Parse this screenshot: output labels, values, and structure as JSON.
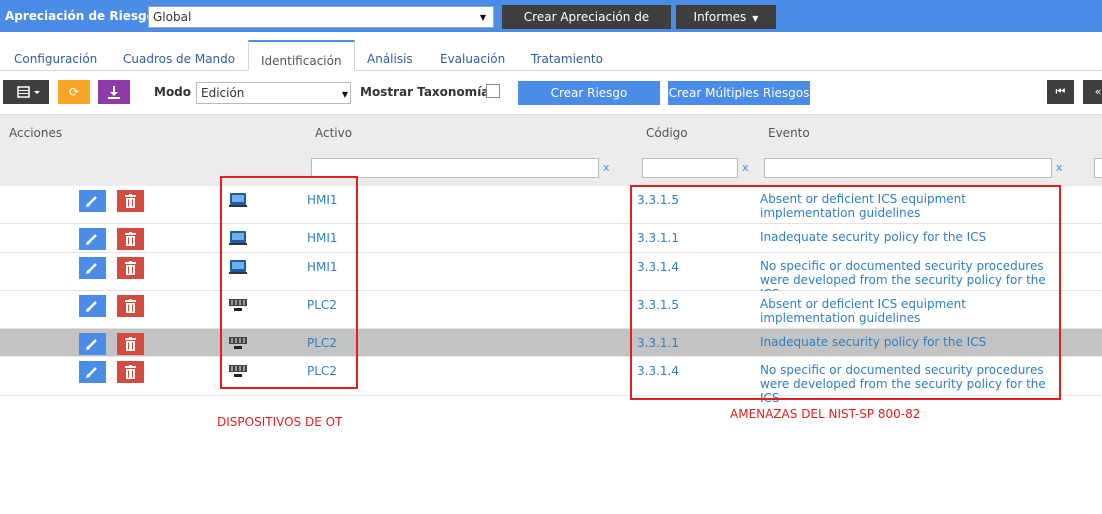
{
  "topbar": {
    "title": "Apreciación de Riesgos",
    "scope_value": "Global",
    "create_button": "Crear Apreciación de Riesgos",
    "reports_button": "Informes"
  },
  "tabs": [
    {
      "label": "Configuración"
    },
    {
      "label": "Cuadros de Mando"
    },
    {
      "label": "Identificación",
      "active": true
    },
    {
      "label": "Análisis"
    },
    {
      "label": "Evaluación"
    },
    {
      "label": "Tratamiento"
    }
  ],
  "toolbar": {
    "mode_label": "Modo",
    "mode_value": "Edición",
    "taxonomy_label": "Mostrar Taxonomía",
    "create_risk": "Crear Riesgo",
    "create_multiple": "Crear Múltiples Riesgos"
  },
  "table": {
    "columns": [
      "Acciones",
      "Activo",
      "Código",
      "Evento"
    ],
    "filter_clear": "x",
    "rows": [
      {
        "activo": "HMI1",
        "device": "hmi",
        "codigo": "3.3.1.5",
        "evento": "Absent or deficient ICS equipment implementation guidelines"
      },
      {
        "activo": "HMI1",
        "device": "hmi",
        "codigo": "3.3.1.1",
        "evento": "Inadequate security policy for the ICS"
      },
      {
        "activo": "HMI1",
        "device": "hmi",
        "codigo": "3.3.1.4",
        "evento": "No specific or documented security procedures were developed from the security policy for the ICS"
      },
      {
        "activo": "PLC2",
        "device": "plc",
        "codigo": "3.3.1.5",
        "evento": "Absent or deficient ICS equipment implementation guidelines"
      },
      {
        "activo": "PLC2",
        "device": "plc",
        "codigo": "3.3.1.1",
        "evento": "Inadequate security policy for the ICS",
        "selected": true
      },
      {
        "activo": "PLC2",
        "device": "plc",
        "codigo": "3.3.1.4",
        "evento": "No specific or documented security procedures were developed from the security policy for the ICS"
      }
    ]
  },
  "annotations": {
    "devices_label": "DISPOSITIVOS DE OT",
    "threats_label": "AMENAZAS DEL NIST-SP 800-82",
    "color": "#e41e1e"
  },
  "colors": {
    "topbar": "#4b8de6",
    "link": "#2e7fc1",
    "edit": "#4b8de6",
    "delete": "#d24b3e",
    "refresh": "#f6a623",
    "download": "#8e3aa8"
  }
}
